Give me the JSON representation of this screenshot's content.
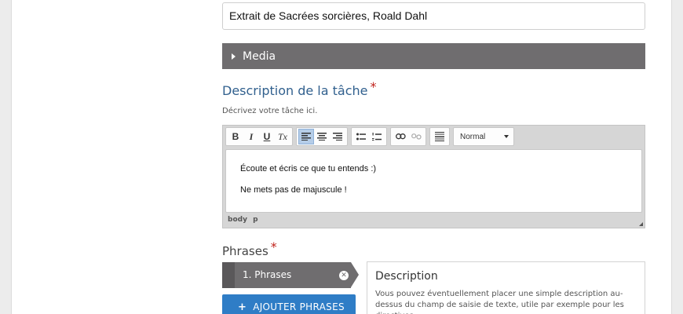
{
  "form": {
    "title_value": "Extrait de Sacrées sorcières, Roald Dahl",
    "media_label": "Media",
    "task_description": {
      "title": "Description de la tâche",
      "required_mark": "*",
      "hint": "Décrivez votre tâche ici."
    },
    "editor": {
      "toolbar": {
        "bold": "B",
        "italic": "I",
        "underline": "U",
        "remove_format": "Tx",
        "format_value": "Normal"
      },
      "paragraphs": [
        "Écoute et écris ce que tu entends :)",
        "Ne mets pas de majuscule !"
      ],
      "path": [
        "body",
        "p"
      ]
    },
    "phrases": {
      "title": "Phrases",
      "required_mark": "*",
      "tab_label": "1. Phrases",
      "close_glyph": "✕",
      "add_button": "AJOUTER PHRASES",
      "add_icon": "+"
    },
    "description_panel": {
      "title": "Description",
      "text": "Vous pouvez éventuellement placer une simple description au-dessus du champ de saisie de texte, utile par exemple pour les directives."
    }
  },
  "colors": {
    "accent_blue": "#2f7dc6",
    "title_blue": "#31608e",
    "bar_gray": "#6f6d6f",
    "required_red": "#c0221b"
  }
}
